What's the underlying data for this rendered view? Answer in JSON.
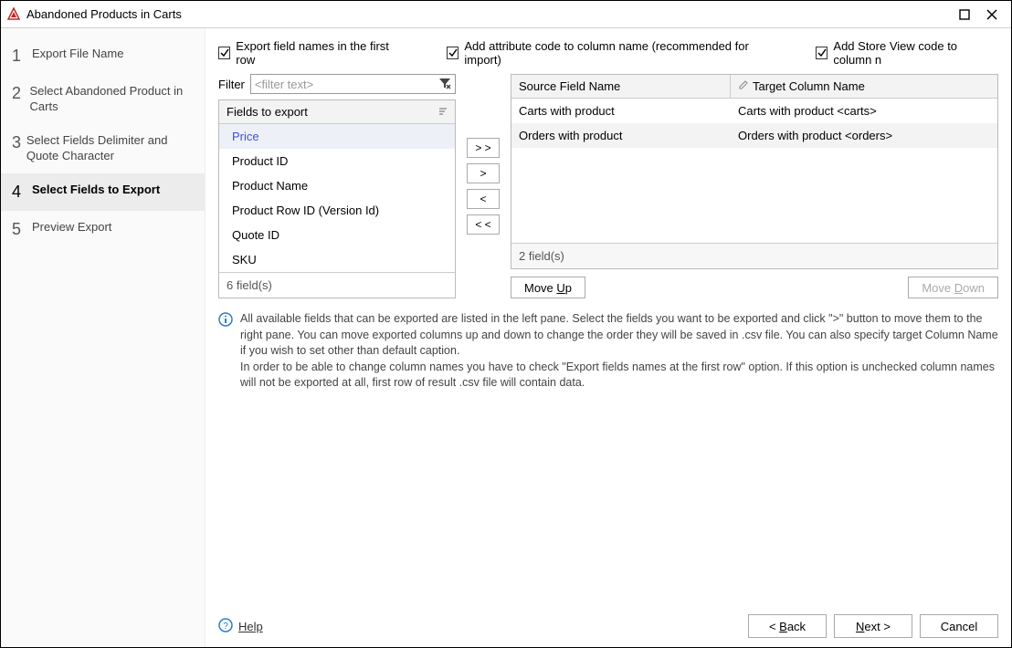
{
  "title": "Abandoned Products in Carts",
  "steps": [
    {
      "num": "1",
      "label": "Export File Name"
    },
    {
      "num": "2",
      "label": "Select Abandoned Product in Carts"
    },
    {
      "num": "3",
      "label": "Select Fields Delimiter and Quote Character"
    },
    {
      "num": "4",
      "label": "Select Fields to Export"
    },
    {
      "num": "5",
      "label": "Preview Export"
    }
  ],
  "checkboxes": {
    "export_names": "Export field names in the  first row",
    "add_attr": "Add attribute code to column name (recommended for import)",
    "add_store": "Add Store View code to column n"
  },
  "filter": {
    "label": "Filter",
    "placeholder": "<filter text>"
  },
  "fields_header": "Fields to export",
  "fields": [
    "Price",
    "Product ID",
    "Product Name",
    "Product Row ID (Version Id)",
    "Quote ID",
    "SKU"
  ],
  "fields_count": "6 field(s)",
  "move": {
    "all_right": "> >",
    "right": ">",
    "left": "<",
    "all_left": "< <"
  },
  "grid": {
    "col1": "Source Field Name",
    "col2": "Target Column Name",
    "rows": [
      {
        "src": "Carts with product",
        "tgt": "Carts with product <carts>"
      },
      {
        "src": "Orders with product",
        "tgt": "Orders with product <orders>"
      }
    ],
    "count": "2 field(s)"
  },
  "updown": {
    "up": "Move Up",
    "down": "Move Down"
  },
  "info_text": "All available fields that can be exported are listed in the left pane. Select the fields you want to be exported and click \">\" button to move them to the right pane. You can move exported columns up and down to change the order they will be saved in .csv file. You can also specify target Column Name if you wish to set other than default caption.\nIn order to be able to change column names you have to check \"Export fields names at the first row\" option. If this option is unchecked column names will not be exported at all, first row of result .csv file will contain data.",
  "help": "Help",
  "nav": {
    "back": "< Back",
    "next": "Next >",
    "cancel": "Cancel"
  }
}
